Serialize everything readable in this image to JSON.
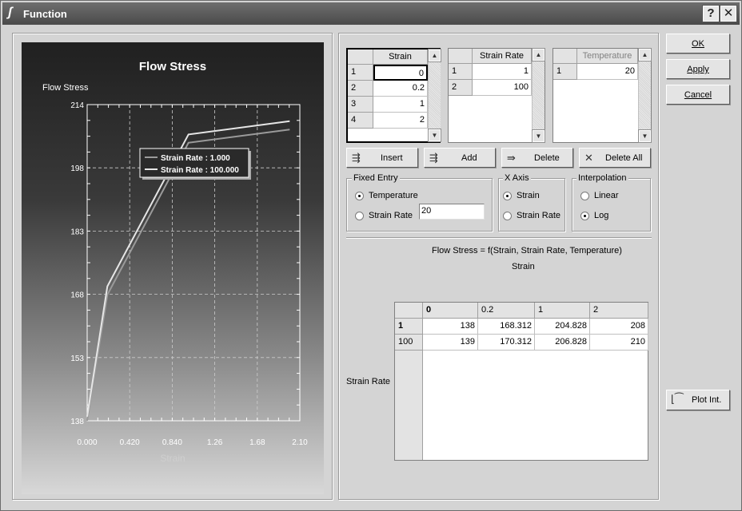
{
  "window": {
    "title": "Function",
    "help_glyph": "?",
    "close_glyph": "✕",
    "app_glyph": "ʃ"
  },
  "chart_data": {
    "type": "line",
    "title": "Flow Stress",
    "ylabel": "Flow Stress",
    "xlabel": "Strain",
    "xlim": [
      0,
      2.1
    ],
    "ylim": [
      138,
      214
    ],
    "xticks": [
      "0.000",
      "0.420",
      "0.840",
      "1.26",
      "1.68",
      "2.10"
    ],
    "yticks": [
      "214",
      "198",
      "183",
      "168",
      "153",
      "138"
    ],
    "grid": true,
    "legend_placement": "top-center",
    "series": [
      {
        "name": "Strain Rate : 1.000",
        "x": [
          0,
          0.2,
          1,
          2
        ],
        "y": [
          138,
          168.312,
          204.828,
          208
        ],
        "color": "#9a9a9a"
      },
      {
        "name": "Strain Rate : 100.000",
        "x": [
          0,
          0.2,
          1,
          2
        ],
        "y": [
          139,
          170.312,
          206.828,
          210
        ],
        "color": "#e6e6e6"
      }
    ]
  },
  "strain_grid": {
    "header": "Strain",
    "rows": [
      {
        "idx": "1",
        "val": "0"
      },
      {
        "idx": "2",
        "val": "0.2"
      },
      {
        "idx": "3",
        "val": "1"
      },
      {
        "idx": "4",
        "val": "2"
      }
    ]
  },
  "strainrate_grid": {
    "header": "Strain Rate",
    "rows": [
      {
        "idx": "1",
        "val": "1"
      },
      {
        "idx": "2",
        "val": "100"
      }
    ]
  },
  "temperature_grid": {
    "header": "Temperature",
    "rows": [
      {
        "idx": "1",
        "val": "20"
      }
    ]
  },
  "toolbar": {
    "insert": "Insert",
    "add": "Add",
    "delete": "Delete",
    "delete_all": "Delete All"
  },
  "fixed_entry": {
    "legend": "Fixed Entry",
    "opt_temperature": "Temperature",
    "opt_strain_rate": "Strain Rate",
    "value": "20"
  },
  "x_axis": {
    "legend": "X Axis",
    "opt_strain": "Strain",
    "opt_strain_rate": "Strain Rate"
  },
  "interpolation": {
    "legend": "Interpolation",
    "opt_linear": "Linear",
    "opt_log": "Log"
  },
  "formula": {
    "text": "Flow Stress = f(Strain, Strain Rate, Temperature)",
    "col_axis_label": "Strain",
    "row_axis_label": "Strain Rate"
  },
  "result_table": {
    "columns": [
      "0",
      "0.2",
      "1",
      "2"
    ],
    "rows": [
      {
        "label": "1",
        "values": [
          "138",
          "168.312",
          "204.828",
          "208"
        ]
      },
      {
        "label": "100",
        "values": [
          "139",
          "170.312",
          "206.828",
          "210"
        ]
      }
    ]
  },
  "buttons": {
    "ok": "OK",
    "apply": "Apply",
    "cancel": "Cancel",
    "plot_int": "Plot Int."
  }
}
